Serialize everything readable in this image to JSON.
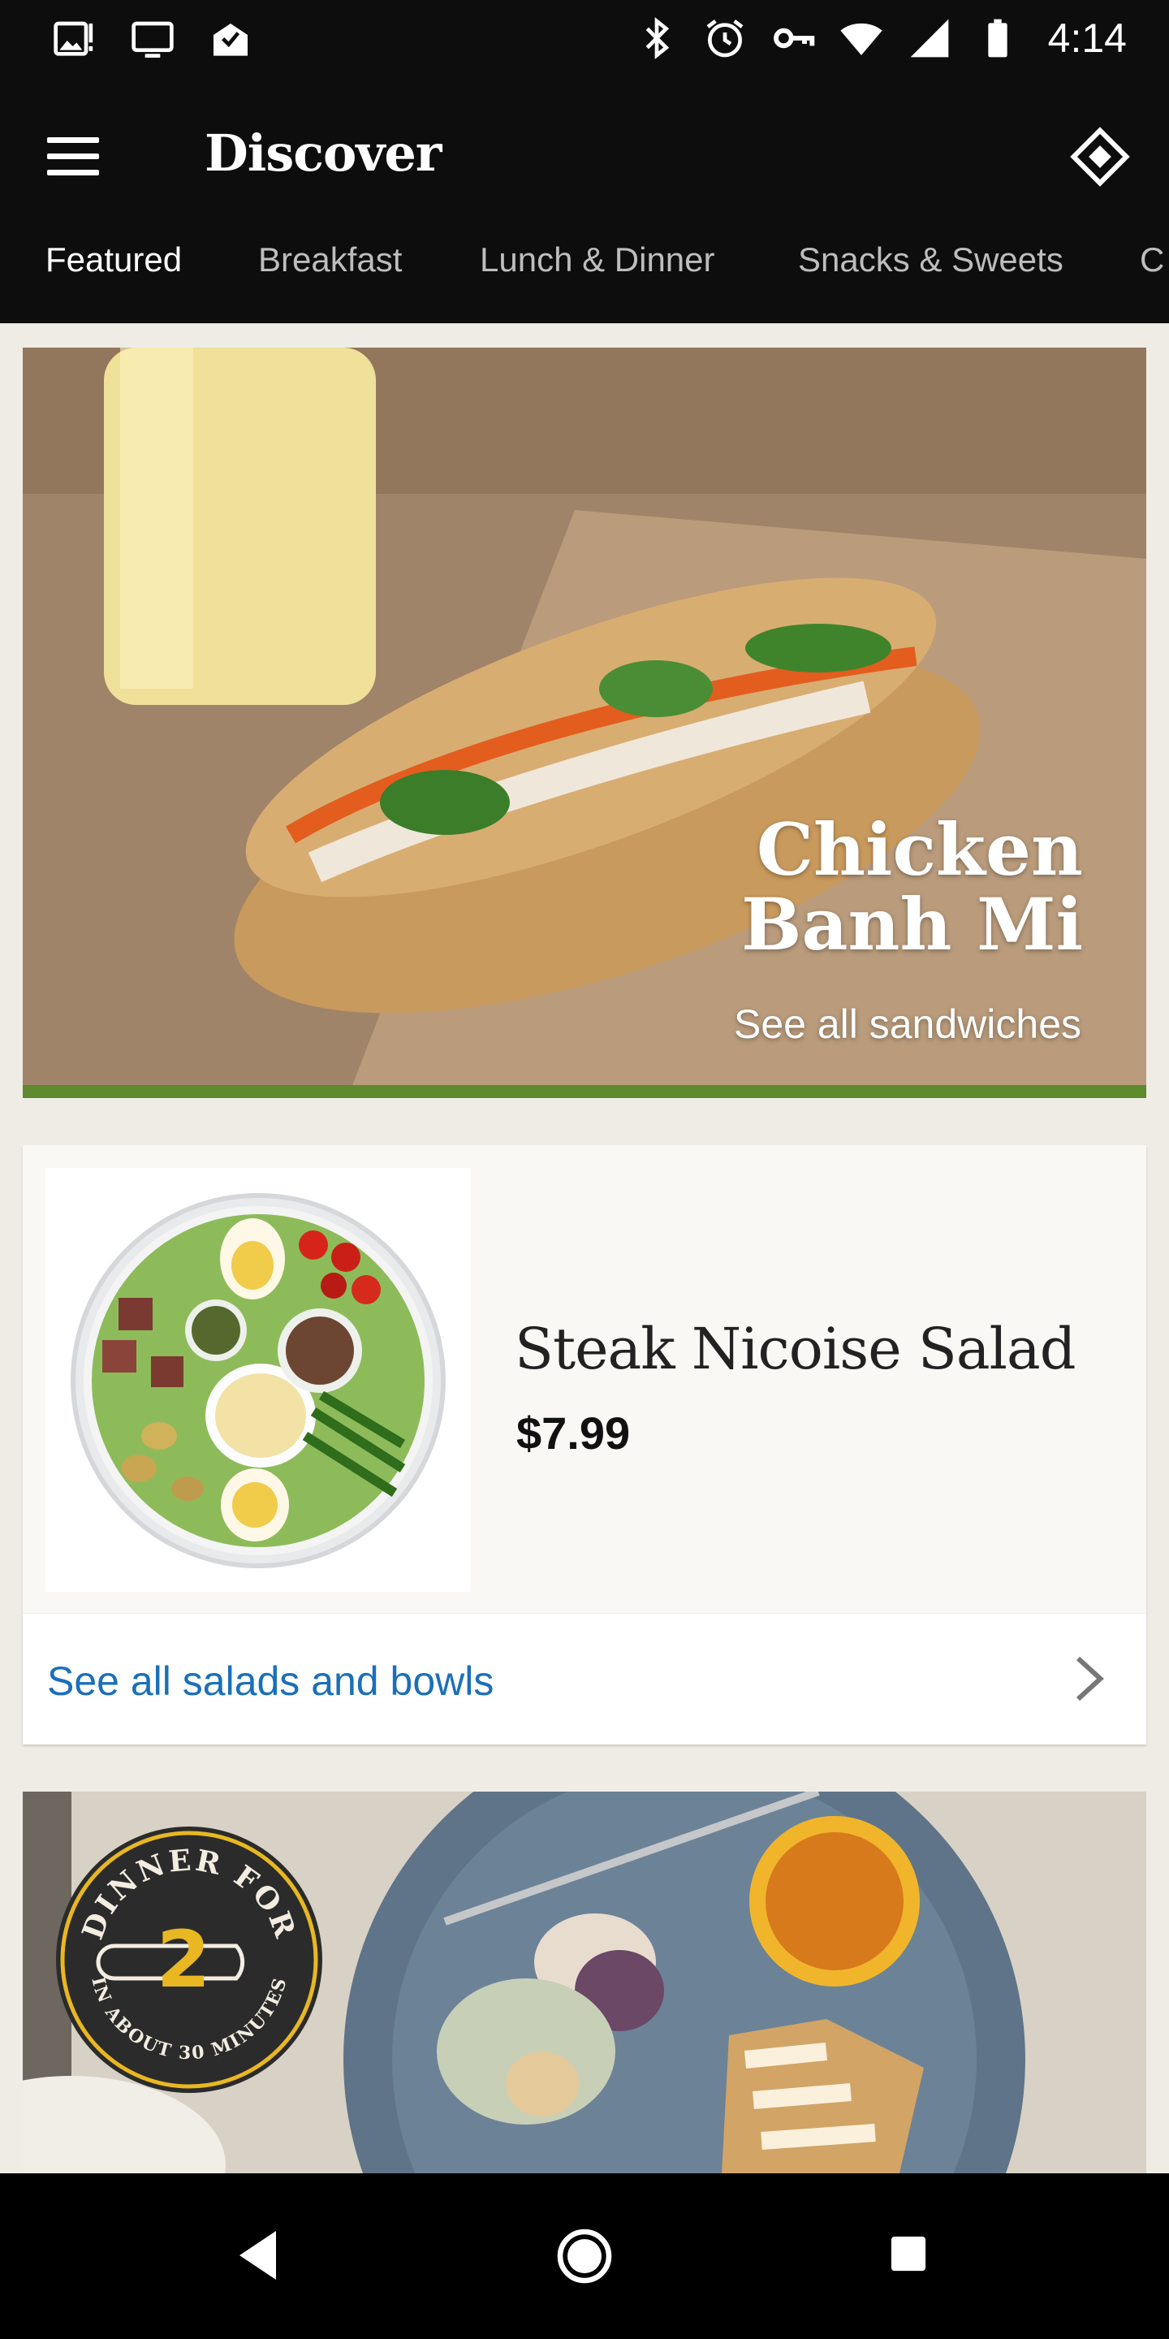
{
  "status_bar": {
    "time": "4:14",
    "icons": [
      "image-alert-icon",
      "cast-icon",
      "mail-check-icon",
      "bluetooth-icon",
      "alarm-icon",
      "vpn-key-icon",
      "wifi-icon",
      "cell-signal-icon",
      "battery-icon"
    ]
  },
  "app_bar": {
    "title": "Discover",
    "menu_icon": "menu-icon",
    "directions_icon": "directions-diamond-icon"
  },
  "tabs": [
    {
      "label": "Featured",
      "active": true
    },
    {
      "label": "Breakfast",
      "active": false
    },
    {
      "label": "Lunch & Dinner",
      "active": false
    },
    {
      "label": "Snacks & Sweets",
      "active": false
    },
    {
      "label": "C",
      "active": false
    }
  ],
  "hero": {
    "title_line1": "Chicken",
    "title_line2": "Banh Mi",
    "subtitle": "See all sandwiches",
    "accent_color": "#5e8a2e"
  },
  "product": {
    "name": "Steak Nicoise Salad",
    "price": "$7.99",
    "see_all": "See all salads and bowls"
  },
  "dinner": {
    "badge_top": "DINNER FOR",
    "badge_number": "2",
    "badge_bottom": "IN ABOUT 30 MINUTES",
    "badge_accent": "#e8b722"
  },
  "colors": {
    "header_bg": "#0d0d0d",
    "page_bg": "#efece5",
    "link_blue": "#1b6fb9"
  }
}
